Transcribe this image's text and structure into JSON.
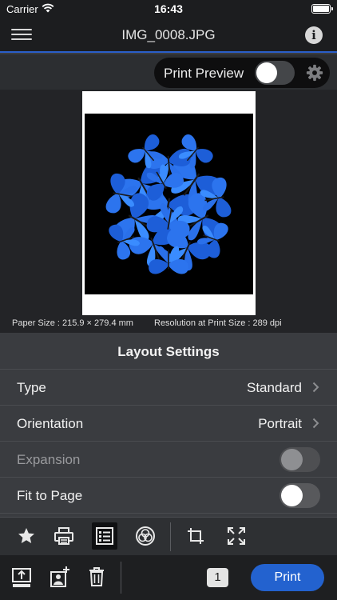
{
  "status_bar": {
    "carrier": "Carrier",
    "time": "16:43"
  },
  "nav": {
    "title": "IMG_0008.JPG",
    "menu_icon": "hamburger-menu-icon",
    "info_icon": "info-icon",
    "info_glyph": "i"
  },
  "preview": {
    "label": "Print Preview",
    "enabled": false
  },
  "paper_info": {
    "paper_size": "Paper Size : 215.9 × 279.4 mm",
    "resolution": "Resolution at Print Size : 289 dpi"
  },
  "layout_settings": {
    "title": "Layout Settings",
    "type": {
      "label": "Type",
      "value": "Standard"
    },
    "orientation": {
      "label": "Orientation",
      "value": "Portrait"
    },
    "expansion": {
      "label": "Expansion",
      "enabled": false,
      "disabled": true
    },
    "fit_to_page": {
      "label": "Fit to Page",
      "enabled": false
    }
  },
  "tools": [
    "star-icon",
    "printer-icon",
    "layout-settings-icon",
    "color-adjust-icon",
    "crop-icon",
    "fit-expand-icon"
  ],
  "actions": {
    "copies": "1",
    "print_label": "Print"
  },
  "colors": {
    "accent": "#2362cf",
    "nav_underline": "#2a5ec8",
    "butterfly_blue": "#1e6ff0"
  }
}
